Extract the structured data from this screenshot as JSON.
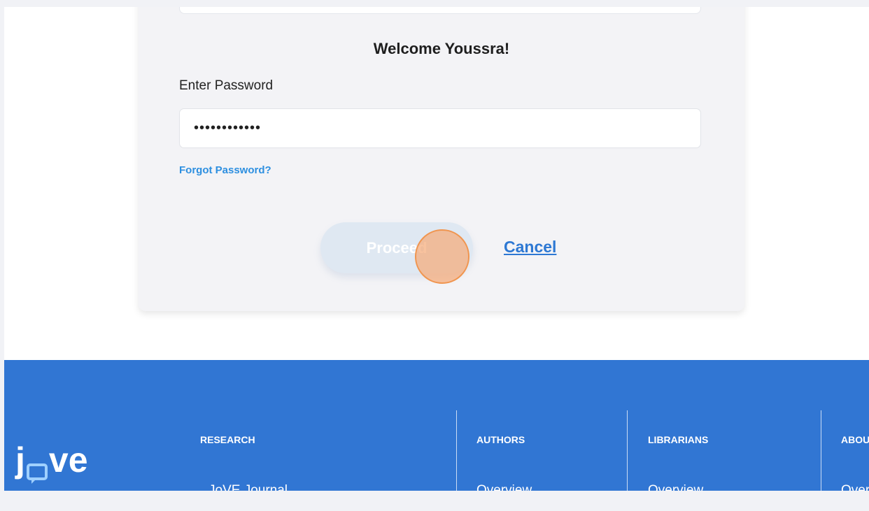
{
  "login": {
    "welcome": "Welcome Youssra!",
    "password_label": "Enter Password",
    "password_value": "••••••••••••",
    "forgot_link": "Forgot Password?",
    "proceed_label": "Proceed",
    "cancel_label": "Cancel"
  },
  "footer": {
    "logo_text_left": "j",
    "logo_text_right": "ve",
    "columns": [
      {
        "heading": "RESEARCH",
        "first_link": "JoVE Journal"
      },
      {
        "heading": "AUTHORS",
        "first_link": "Overview"
      },
      {
        "heading": "LIBRARIANS",
        "first_link": "Overview"
      },
      {
        "heading": "ABOUT",
        "first_link": "Overview"
      }
    ]
  },
  "colors": {
    "footer_bg": "#3176d3",
    "link_blue": "#2d8fe0",
    "cancel_blue": "#2d78d3",
    "click_indicator": "#f0954f"
  }
}
